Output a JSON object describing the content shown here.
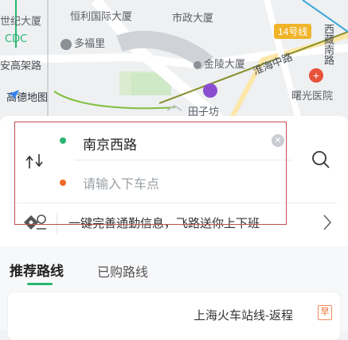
{
  "map": {
    "labels": {
      "world_center": "世纪大厦",
      "cdc": "CDC",
      "hengcai": "恒利国际大厦",
      "shizheng": "市政大厦",
      "duofuli": "多福里",
      "jinling": "金陵大厦",
      "yanan": "安高架路",
      "huaihai": "淮海中路",
      "xizang": "西藏南路",
      "line14": "14号线",
      "hospital": "曙光医院",
      "tianzi": "田子坊"
    },
    "brand": "高德地图",
    "accent_line_color": "#8fb82b"
  },
  "search": {
    "from_value": "南京西路",
    "to_placeholder": "请输入下车点",
    "from_dot_color": "#2bb673",
    "to_dot_color": "#f06a2a"
  },
  "commute": {
    "text": "一键完善通勤信息，飞路送你上下班"
  },
  "tabs": {
    "recommended": "推荐路线",
    "purchased": "已购路线"
  },
  "route": {
    "name": "上海火车站线-返程",
    "tag": "早"
  },
  "icons": {
    "swap": "swap-icon",
    "clear": "clear-icon",
    "search": "search-icon",
    "commute": "commute-icon",
    "chevron": "chevron-right-icon"
  }
}
